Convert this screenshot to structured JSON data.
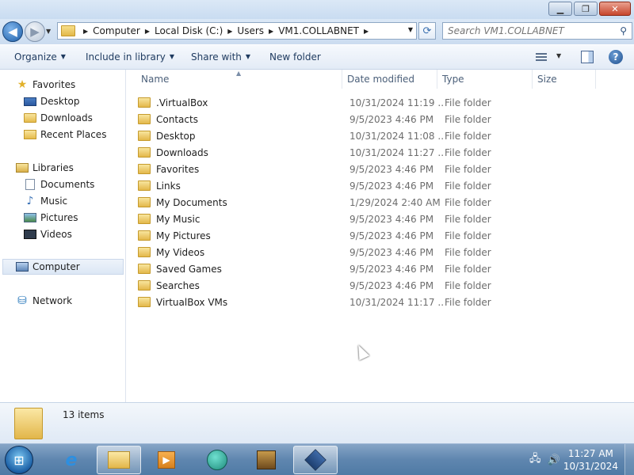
{
  "window": {
    "minimize_glyph": "▁",
    "maximize_glyph": "❐",
    "close_glyph": "✕"
  },
  "address": {
    "back_glyph": "◀",
    "forward_glyph": "▶",
    "breadcrumbs": [
      "Computer",
      "Local Disk (C:)",
      "Users",
      "VM1.COLLABNET"
    ],
    "refresh_glyph": "⟳"
  },
  "search": {
    "placeholder": "Search VM1.COLLABNET",
    "icon": "search-icon"
  },
  "commands": {
    "organize": "Organize",
    "include_in_library": "Include in library",
    "share_with": "Share with",
    "new_folder": "New folder"
  },
  "nav": {
    "favorites": "Favorites",
    "desktop": "Desktop",
    "downloads": "Downloads",
    "recent_places": "Recent Places",
    "libraries": "Libraries",
    "documents": "Documents",
    "music": "Music",
    "pictures": "Pictures",
    "videos": "Videos",
    "computer": "Computer",
    "network": "Network"
  },
  "columns": {
    "name": "Name",
    "date_modified": "Date modified",
    "type": "Type",
    "size": "Size"
  },
  "files": [
    {
      "name": ".VirtualBox",
      "date": "10/31/2024 11:19 ...",
      "type": "File folder"
    },
    {
      "name": "Contacts",
      "date": "9/5/2023 4:46 PM",
      "type": "File folder"
    },
    {
      "name": "Desktop",
      "date": "10/31/2024 11:08 ...",
      "type": "File folder"
    },
    {
      "name": "Downloads",
      "date": "10/31/2024 11:27 ...",
      "type": "File folder"
    },
    {
      "name": "Favorites",
      "date": "9/5/2023 4:46 PM",
      "type": "File folder"
    },
    {
      "name": "Links",
      "date": "9/5/2023 4:46 PM",
      "type": "File folder"
    },
    {
      "name": "My Documents",
      "date": "1/29/2024 2:40 AM",
      "type": "File folder"
    },
    {
      "name": "My Music",
      "date": "9/5/2023 4:46 PM",
      "type": "File folder"
    },
    {
      "name": "My Pictures",
      "date": "9/5/2023 4:46 PM",
      "type": "File folder"
    },
    {
      "name": "My Videos",
      "date": "9/5/2023 4:46 PM",
      "type": "File folder"
    },
    {
      "name": "Saved Games",
      "date": "9/5/2023 4:46 PM",
      "type": "File folder"
    },
    {
      "name": "Searches",
      "date": "9/5/2023 4:46 PM",
      "type": "File folder"
    },
    {
      "name": "VirtualBox VMs",
      "date": "10/31/2024 11:17 ...",
      "type": "File folder"
    }
  ],
  "details": {
    "item_count": "13 items"
  },
  "taskbar": {
    "time": "11:27 AM",
    "date": "10/31/2024",
    "ie_glyph": "e",
    "media_glyph": "▶",
    "network_tray_glyph": "🖧",
    "volume_tray_glyph": "🔊"
  }
}
